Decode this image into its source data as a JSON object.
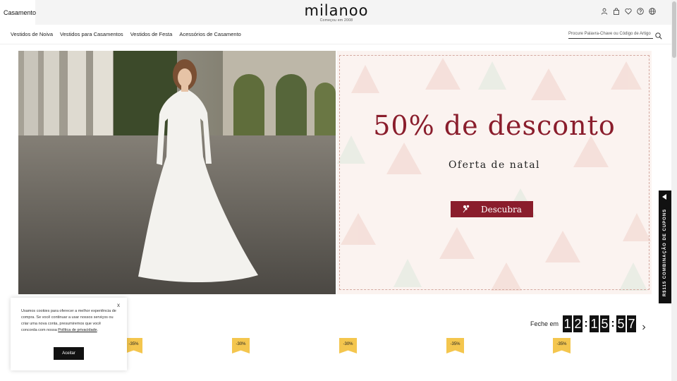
{
  "topbar": {
    "tab_label": "Casamento",
    "logo": "milanoo",
    "tagline": "Começou em 2008",
    "icons": [
      "user-icon",
      "bag-icon",
      "heart-icon",
      "help-icon",
      "globe-icon"
    ]
  },
  "nav": {
    "items": [
      {
        "label": "Vestidos de Noiva"
      },
      {
        "label": "Vestidos para Casamentos"
      },
      {
        "label": "Vestidos de Festa"
      },
      {
        "label": "Acessórios de Casamento"
      }
    ],
    "search_placeholder": "Procure Palavra-Chave ou Código de Artigo"
  },
  "hero": {
    "title": "50% de desconto",
    "subtitle": "Oferta de natal",
    "button_label": "Descubra",
    "accent_color": "#8a1d2c"
  },
  "coupon_tab": {
    "label": "R$115 COMBINAÇÃO DE CUPONS"
  },
  "countdown": {
    "label": "Feche em",
    "digits": [
      "1",
      "2",
      "1",
      "5",
      "5",
      "7"
    ]
  },
  "badges": [
    "-35%",
    "-30%",
    "-30%",
    "-35%",
    "-35%"
  ],
  "cookie": {
    "text": "Usamos cookies para oferecer a melhor experiência de compra. Se você continuar a usar nossos serviços ou criar uma nova conta, presumiremos que você concorda com nossa",
    "link_label": "Política de privacidade",
    "close_label": "x",
    "accept_label": "Aceitar"
  }
}
